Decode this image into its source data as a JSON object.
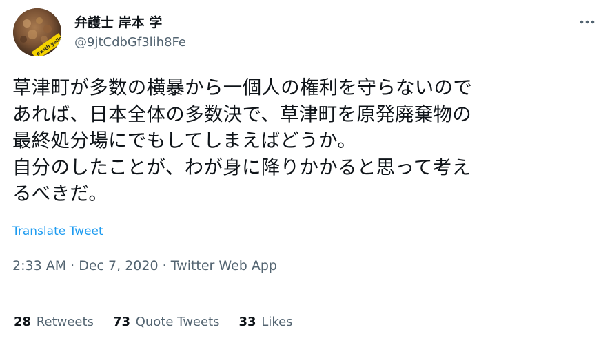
{
  "author": {
    "display_name": "弁護士 岸本 学",
    "handle": "@9jtCdbGf3lih8Fe",
    "avatar_icon": "avatar-photo-icon"
  },
  "tweet": {
    "text": "草津町が多数の横暴から一個人の権利を守らないので\nあれば、日本全体の多数決で、草津町を原発廃棄物の\n最終処分場にでもしてしまえばどうか。\n自分のしたことが、わが身に降りかかると思って考え\nるべきだ。",
    "translate_label": "Translate Tweet",
    "time": "2:33 AM",
    "date": "Dec 7, 2020",
    "source": "Twitter Web App",
    "separator": " · "
  },
  "stats": {
    "retweets_count": "28",
    "retweets_label": "Retweets",
    "quote_count": "73",
    "quote_label": "Quote Tweets",
    "likes_count": "33",
    "likes_label": "Likes"
  },
  "colors": {
    "text_primary": "#0f1419",
    "text_secondary": "#536471",
    "link": "#1d9bf0",
    "divider": "#eff3f4"
  }
}
